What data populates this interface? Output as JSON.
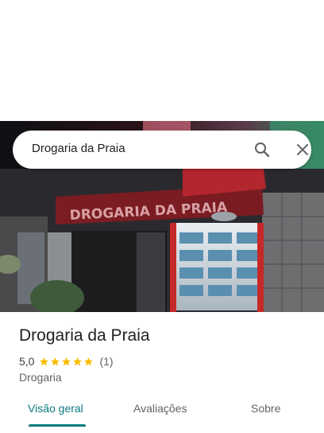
{
  "search": {
    "query": "Drogaria da Praia"
  },
  "hero": {
    "storefront_sign": "DROGARIA DA PRAIA"
  },
  "place": {
    "title": "Drogaria da Praia",
    "rating": "5,0",
    "rating_value": 5,
    "review_count": "(1)",
    "category": "Drogaria"
  },
  "tabs": [
    {
      "label": "Visão geral",
      "active": true
    },
    {
      "label": "Avaliações",
      "active": false
    },
    {
      "label": "Sobre",
      "active": false
    }
  ],
  "colors": {
    "accent": "#0b7a80",
    "star": "#fbbc04",
    "sign_red": "#c62828"
  }
}
